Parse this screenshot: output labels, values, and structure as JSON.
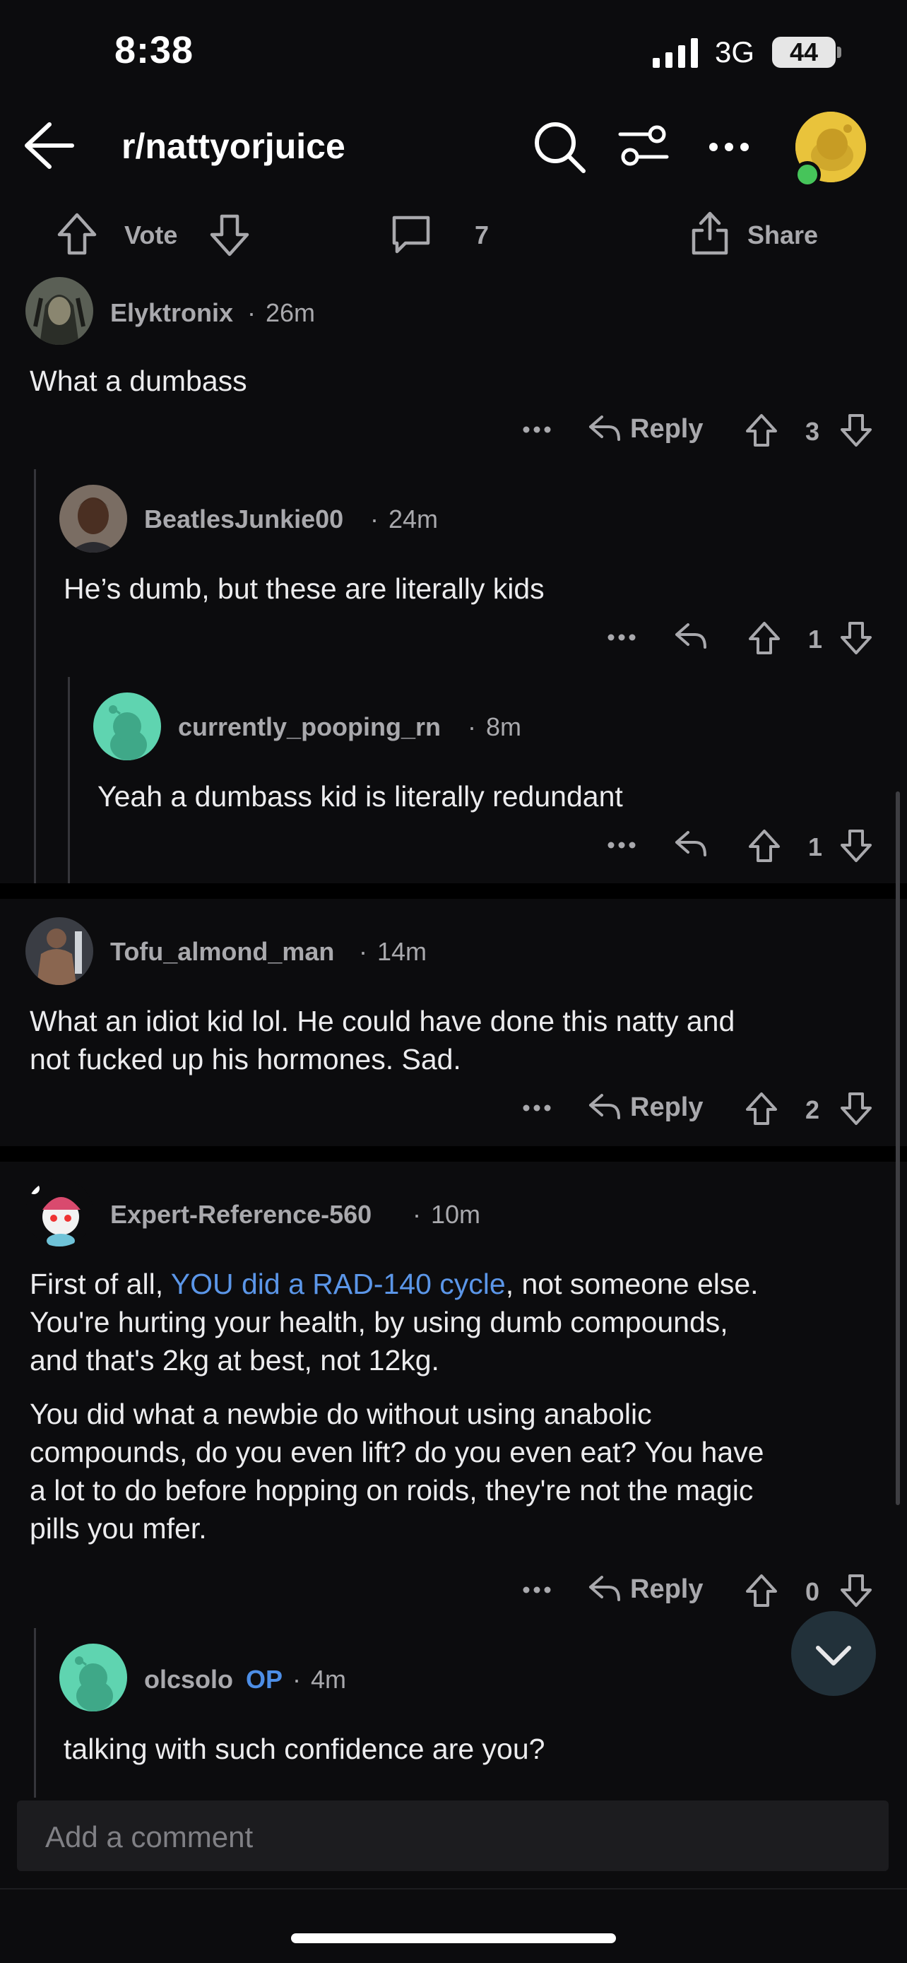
{
  "status": {
    "time": "8:38",
    "network": "3G",
    "battery": "44"
  },
  "header": {
    "subreddit": "r/nattyorjuice"
  },
  "post_actions": {
    "vote_label": "Vote",
    "comment_count": "7",
    "share_label": "Share"
  },
  "comments": [
    {
      "username": "Elyktronix",
      "time": "26m",
      "body": "What a dumbass",
      "score": "3",
      "reply_label": "Reply"
    },
    {
      "username": "BeatlesJunkie00",
      "time": "24m",
      "body": "He’s dumb, but these are literally kids",
      "score": "1"
    },
    {
      "username": "currently_pooping_rn",
      "time": "8m",
      "body": "Yeah a dumbass kid is literally redundant",
      "score": "1"
    },
    {
      "username": "Tofu_almond_man",
      "time": "14m",
      "body_line1": "What an idiot kid lol. He could have done this natty and",
      "body_line2": "not fucked up his hormones. Sad.",
      "score": "2",
      "reply_label": "Reply"
    },
    {
      "username": "Expert-Reference-560",
      "time": "10m",
      "p1_pre": "First of all, ",
      "p1_link": "YOU did a RAD-140 cycle",
      "p1_post": ", not someone else.",
      "p1_line2": "You're hurting your health, by using dumb compounds,",
      "p1_line3": "and that's 2kg at best, not 12kg.",
      "p2_line1": "You did what a newbie do without using anabolic",
      "p2_line2": "compounds, do you even lift? do you even eat? You have",
      "p2_line3": "a lot to do before hopping on roids, they're not the magic",
      "p2_line4": "pills you mfer.",
      "score": "0",
      "reply_label": "Reply"
    },
    {
      "username": "olcsolo",
      "op_badge": "OP",
      "time": "4m",
      "body": "talking with such confidence are you?"
    }
  ],
  "composer": {
    "placeholder": "Add a comment"
  },
  "colors": {
    "background": "#0c0c0e",
    "link": "#5b96e8",
    "op": "#4d8ee6",
    "snoo_green": "#5fd4b0"
  }
}
